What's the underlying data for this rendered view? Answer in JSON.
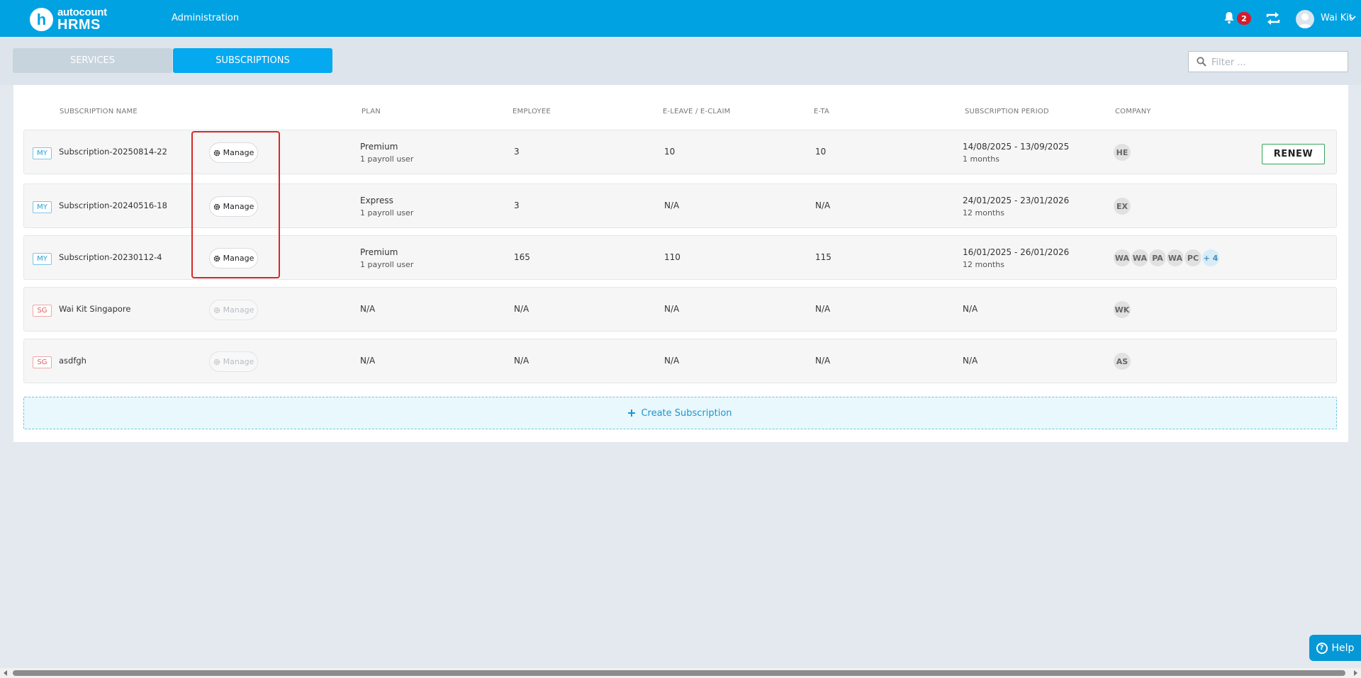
{
  "app": {
    "logo_top": "autocount",
    "logo_bottom": "HRMS",
    "nav_label": "Administration",
    "notification_count": "2",
    "user_name": "Wai Kit"
  },
  "tabs": {
    "services": "SERVICES",
    "subscriptions": "SUBSCRIPTIONS",
    "active": "subscriptions"
  },
  "filter": {
    "placeholder": "Filter ..."
  },
  "columns": {
    "name": "SUBSCRIPTION NAME",
    "plan": "PLAN",
    "employee": "EMPLOYEE",
    "eleave": "E-LEAVE / E-CLAIM",
    "eta": "E-TA",
    "period": "SUBSCRIPTION PERIOD",
    "company": "COMPANY"
  },
  "manage_label": "Manage",
  "renew_label": "RENEW",
  "rows": [
    {
      "country": "MY",
      "name": "Subscription-20250814-22",
      "manage_enabled": true,
      "plan": "Premium",
      "plan_users": "1 payroll user",
      "employee": "3",
      "eleave": "10",
      "eta": "10",
      "period": "14/08/2025 - 13/09/2025",
      "period_length": "1 months",
      "companies": [
        "HE"
      ],
      "more": "",
      "renew": true
    },
    {
      "country": "MY",
      "name": "Subscription-20240516-18",
      "manage_enabled": true,
      "plan": "Express",
      "plan_users": "1 payroll user",
      "employee": "3",
      "eleave": "N/A",
      "eta": "N/A",
      "period": "24/01/2025 - 23/01/2026",
      "period_length": "12 months",
      "companies": [
        "EX"
      ],
      "more": "",
      "renew": false
    },
    {
      "country": "MY",
      "name": "Subscription-20230112-4",
      "manage_enabled": true,
      "plan": "Premium",
      "plan_users": "1 payroll user",
      "employee": "165",
      "eleave": "110",
      "eta": "115",
      "period": "16/01/2025 - 26/01/2026",
      "period_length": "12 months",
      "companies": [
        "WA",
        "WA",
        "PA",
        "WA",
        "PC"
      ],
      "more": "+ 4",
      "renew": false
    },
    {
      "country": "SG",
      "name": "Wai Kit Singapore",
      "manage_enabled": false,
      "plan": "N/A",
      "plan_users": "",
      "employee": "N/A",
      "eleave": "N/A",
      "eta": "N/A",
      "period": "N/A",
      "period_length": "",
      "companies": [
        "WK"
      ],
      "more": "",
      "renew": false
    },
    {
      "country": "SG",
      "name": "asdfgh",
      "manage_enabled": false,
      "plan": "N/A",
      "plan_users": "",
      "employee": "N/A",
      "eleave": "N/A",
      "eta": "N/A",
      "period": "N/A",
      "period_length": "",
      "companies": [
        "AS"
      ],
      "more": "",
      "renew": false
    }
  ],
  "create_label": "Create Subscription",
  "help_label": "Help",
  "colors": {
    "topbar": "#00a2e2",
    "active_tab": "#05a9f0",
    "renew_border": "#33a55b",
    "highlight": "#d62828"
  }
}
